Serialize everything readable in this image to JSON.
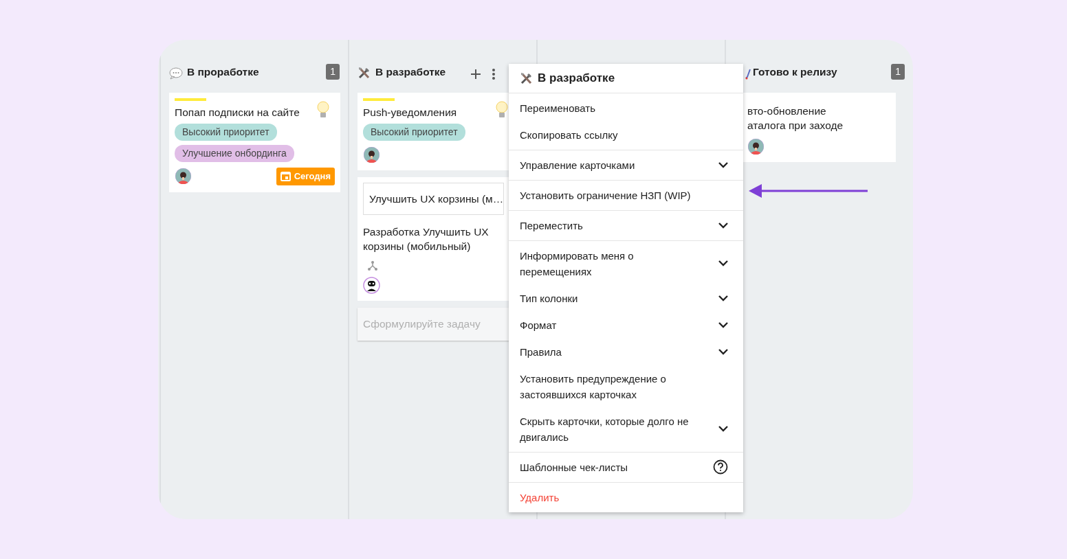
{
  "board": {
    "columns": [
      {
        "kind": "list",
        "title": "В проработке",
        "count": "1",
        "hovered": false,
        "cards": [
          {
            "kind": "task",
            "accent": true,
            "bulb": true,
            "lines": [
              "Попап подписки на сайте"
            ],
            "tags": [
              {
                "label": "Высокий приоритет",
                "color": "#b2dfdb"
              },
              {
                "label": "Улучшение онбординга",
                "color": "#e1bee7"
              }
            ],
            "due": "Сегодня"
          }
        ]
      },
      {
        "kind": "list",
        "title": "В разработке",
        "hovered": true,
        "cards": [
          {
            "kind": "task",
            "accent": true,
            "bulb": true,
            "lines": [
              "Push-уведомления"
            ],
            "tags": [
              {
                "label": "Высокий приоритет",
                "color": "#b2dfdb"
              }
            ]
          },
          {
            "kind": "subtask",
            "accent": false,
            "bulb": false,
            "field": "Улучшить UX корзины (м…",
            "lines": [
              "Разработка Улучшить UX корзины (мобильный)"
            ]
          }
        ],
        "new_card": {
          "placeholder": "Сформулируйте задачу"
        }
      },
      {
        "kind": "covered"
      },
      {
        "kind": "list",
        "title": "Готово к релизу",
        "count": "1",
        "hovered": false,
        "cards": [
          {
            "kind": "task",
            "accent": false,
            "bulb": false,
            "lines": [
              "вто-обновление",
              "аталога при заходе"
            ]
          }
        ]
      }
    ]
  },
  "menu": {
    "title": "В разработке",
    "groups": [
      [
        {
          "kind": "plain",
          "label": "Переименовать"
        },
        {
          "kind": "plain",
          "label": "Скопировать ссылку"
        }
      ],
      [
        {
          "kind": "submenu",
          "label": "Управление карточками"
        }
      ],
      [
        {
          "kind": "plain",
          "label": "Установить ограничение НЗП (WIP)"
        }
      ],
      [
        {
          "kind": "submenu",
          "label": "Переместить"
        }
      ],
      [
        {
          "kind": "submenu",
          "label": "Информировать меня о перемещениях"
        },
        {
          "kind": "submenu",
          "label": "Тип колонки"
        },
        {
          "kind": "submenu",
          "label": "Формат"
        },
        {
          "kind": "submenu",
          "label": "Правила"
        },
        {
          "kind": "plain",
          "label": "Установить предупреждение о застоявшихся карточках"
        },
        {
          "kind": "submenu",
          "label": "Скрыть карточки, которые долго не двигались"
        }
      ],
      [
        {
          "kind": "help",
          "label": "Шаблонные чек-листы"
        }
      ],
      [
        {
          "kind": "danger",
          "label": "Удалить"
        }
      ]
    ]
  }
}
